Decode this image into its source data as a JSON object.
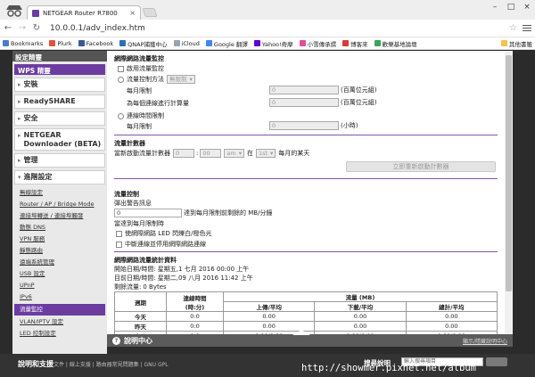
{
  "browser": {
    "tab_title": "NETGEAR Router R7800",
    "tab_close": "×",
    "win_min": "–",
    "win_max": "□",
    "win_close": "×",
    "url": "10.0.0.1/adv_index.htm",
    "bookmarks": [
      {
        "label": "Bookmarks",
        "color": "#4a7bd0"
      },
      {
        "label": "Plurk",
        "color": "#e0533f"
      },
      {
        "label": "Facebook",
        "color": "#3b5998"
      },
      {
        "label": "QNAP捕獲中心",
        "color": "#2d6fb7"
      },
      {
        "label": "iCloud",
        "color": "#9aa4ad"
      },
      {
        "label": "Google 翻譯",
        "color": "#4285f4"
      },
      {
        "label": "Yahoo!奇摩",
        "color": "#6001d2"
      },
      {
        "label": "小雪傳承撰",
        "color": "#e04f9a"
      },
      {
        "label": "博客來",
        "color": "#d83b3b"
      },
      {
        "label": "歡樂基地論壇",
        "color": "#3da35d"
      }
    ],
    "bookmarks_other": "其他書籤"
  },
  "sidebar": {
    "top_label": "設定精靈",
    "wps_label": "WPS 精靈",
    "sections": [
      {
        "label": "安裝"
      },
      {
        "label": "ReadySHARE"
      },
      {
        "label": "安全"
      }
    ],
    "netgear_label": "NETGEAR Downloader (BETA)",
    "manage_label": "管理",
    "advanced_label": "進階設定",
    "sub_items": [
      "無線設定",
      "Router / AP / Bridge Mode",
      "連接埠轉送 / 連接埠觸發",
      "動態 DNS",
      "VPN 服務",
      "靜態路由",
      "遠端系統管理",
      "USB 設定",
      "UPnP",
      "IPv6",
      "流量監控",
      "VLAN/IPTV 設定",
      "LED 控制設定"
    ]
  },
  "content": {
    "limit": {
      "title": "網際網路流量監控",
      "enable_label": "啟用流量監控",
      "volume_label": "流量控制方法",
      "volume_method": "無限制",
      "monthly_label": "每月限制",
      "monthly_value": "0",
      "monthly_unit": "(百萬位元組)",
      "round_label": "為每個連線進行計算量",
      "round_value": "0",
      "round_unit": "(百萬位元組)",
      "time_label": "連線時間限制",
      "time_monthly_label": "每月限制",
      "time_value": "0",
      "time_unit": "(小時)"
    },
    "counter": {
      "title": "流量計數器",
      "restart_label": "當新啟動流量計數器",
      "hour": "0",
      "minute": "00",
      "ampm": "am",
      "on": "在",
      "day": "1st",
      "day_suffix": "每月的某天",
      "restart_button": "立即重新啟動計數器"
    },
    "control": {
      "title": "流量控制",
      "popup_label": "彈出警告訊息",
      "popup_value": "0",
      "popup_suffix": "達到每月限制前剩餘的 MB/分鐘",
      "when_label": "當達到每月限制時",
      "led_label": "使網際網路 LED 閃爍白/橙色光",
      "disconnect_label": "中斷連線並停用網際網路連線"
    },
    "stats": {
      "title": "網際網路流量統計資料",
      "start_label": "開始日期/時間:",
      "start_value": "星期五,1 七月 2016 00:00 上午",
      "current_label": "目前日期/時間:",
      "current_value": "星期二,09 八月 2016 11:42 上午",
      "remain_label": "剩餘流量:",
      "remain_value": "0 Bytes",
      "headers": {
        "period": "週期",
        "conn_time": "連線時間",
        "conn_unit": "(時:分)",
        "volume": "流量 (MB)",
        "upload": "上傳/平均",
        "download": "下載/平均",
        "total": "總計/平均"
      },
      "rows": [
        {
          "period": "今天",
          "time": "0:0",
          "up": "0.00",
          "down": "0.00",
          "total": "0.00"
        },
        {
          "period": "昨天",
          "time": "0:0",
          "up": "0.00",
          "down": "0.00",
          "total": "0.00"
        },
        {
          "period": "本週",
          "time": "0:0",
          "up": "0.00/0.00",
          "down": "0.00/0.00",
          "total": "0.00/0.00"
        }
      ]
    }
  },
  "helpbar": {
    "icon": "?",
    "title": "說明中心",
    "right_link": "顯示/隱藏說明中心"
  },
  "footer": {
    "help_title": "說明和支援",
    "links": "文件 | 線上支援 | 路由器常見問題集 | GNU GPL",
    "search_title": "搜尋說明",
    "search_placeholder": "輸入搜尋項目"
  },
  "watermark": "http://showmer.pixnet.net/album"
}
